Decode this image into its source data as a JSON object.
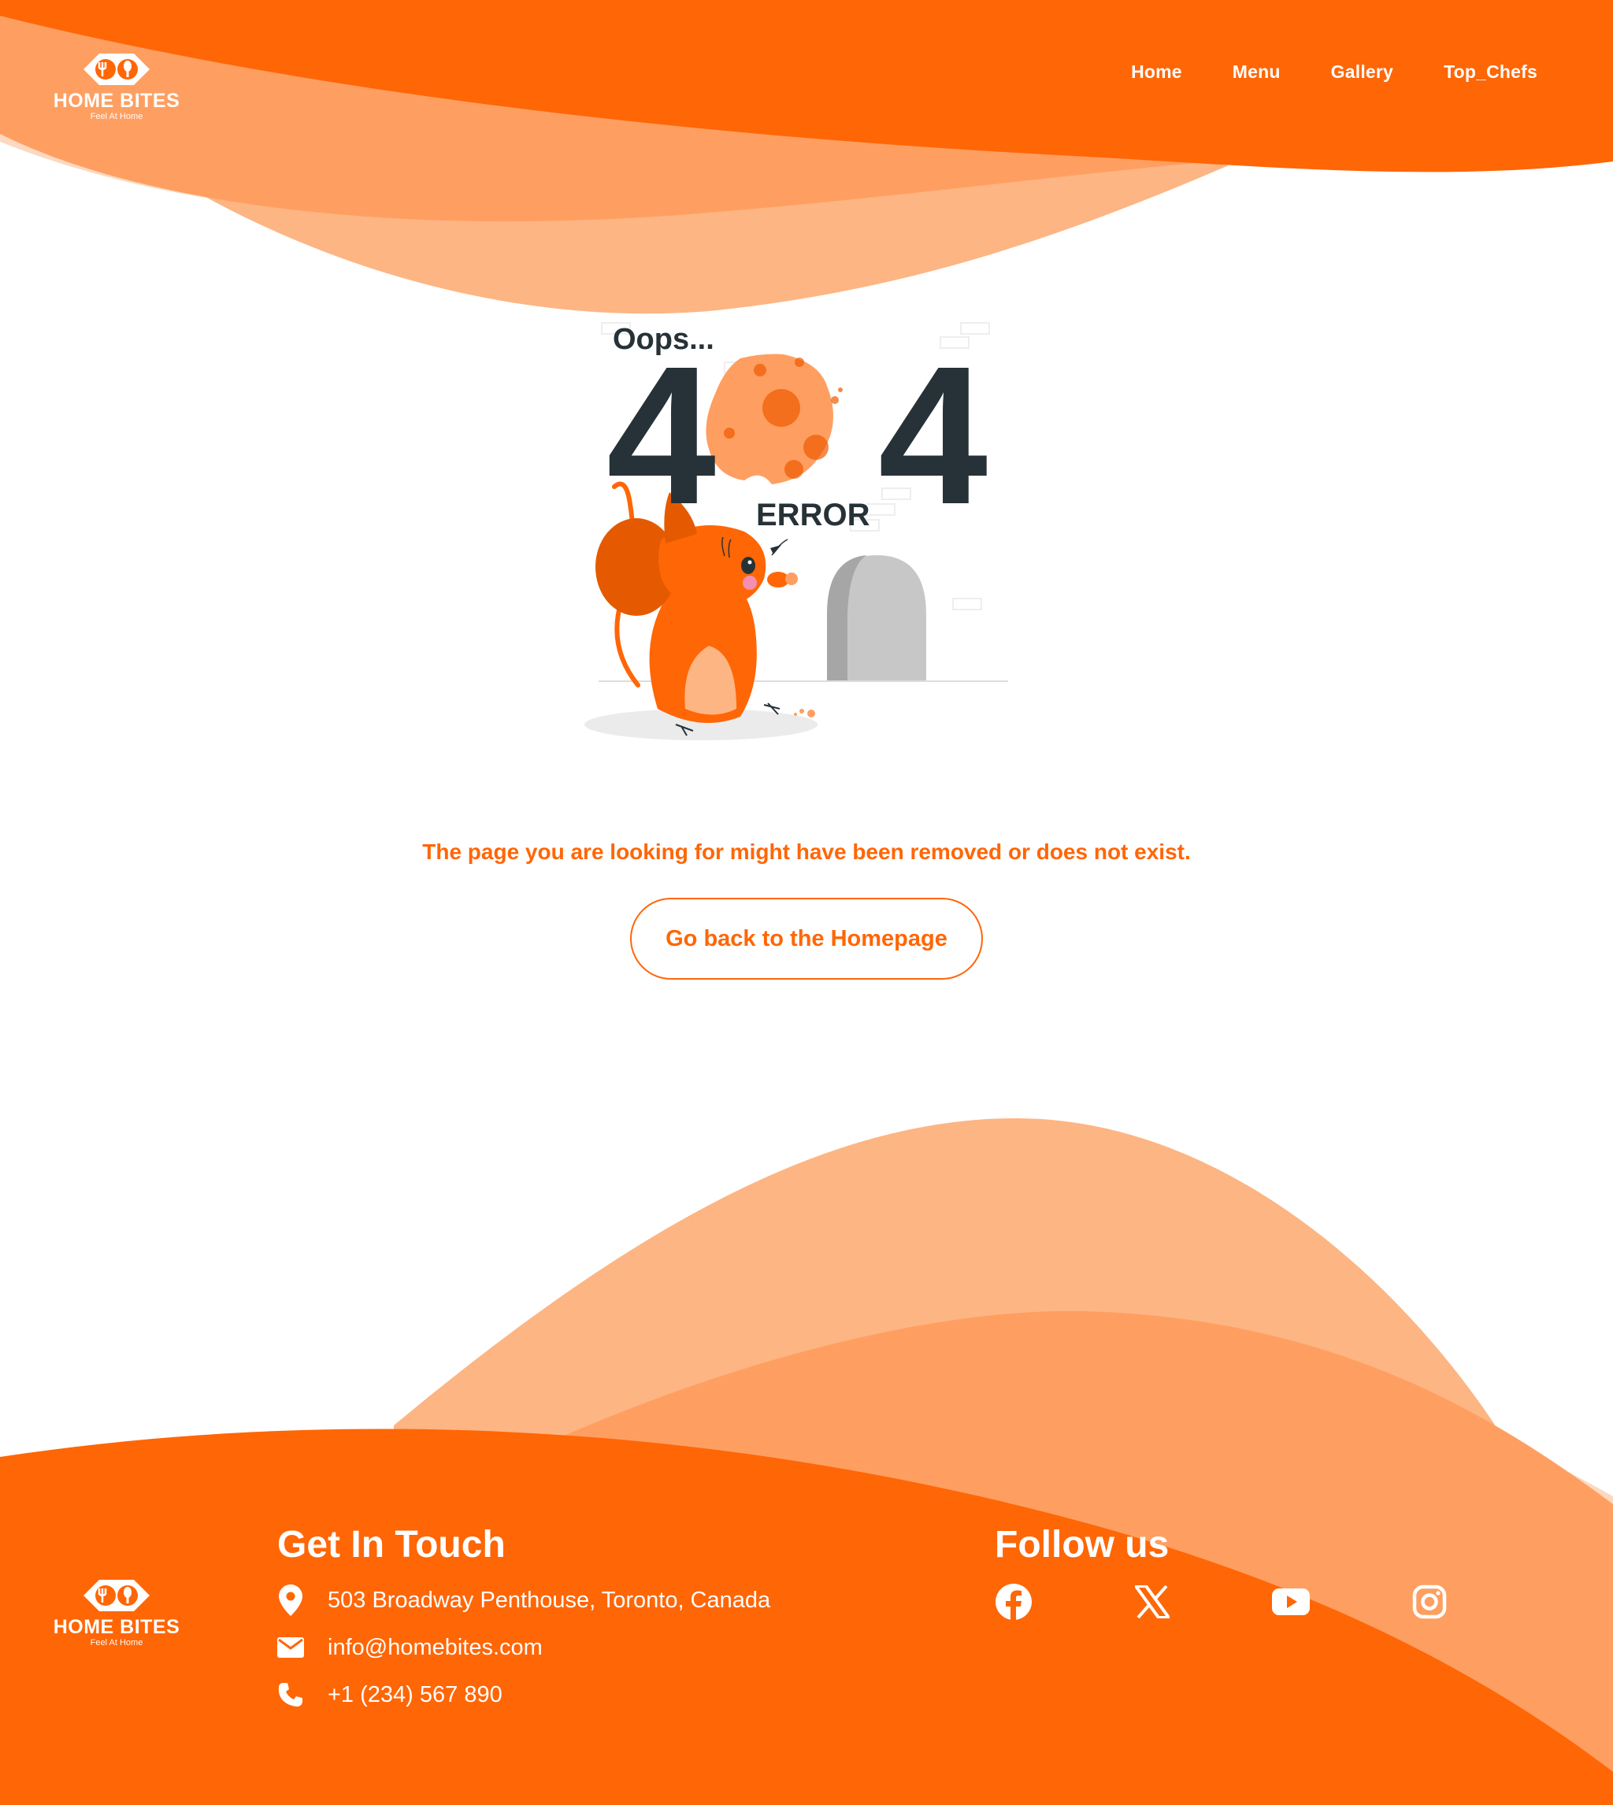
{
  "brand": {
    "name": "HOME BITES",
    "tagline": "Feel At Home"
  },
  "nav": {
    "items": [
      {
        "label": "Home"
      },
      {
        "label": "Menu"
      },
      {
        "label": "Gallery"
      },
      {
        "label": "Top_Chefs"
      }
    ]
  },
  "illustration": {
    "oops": "Oops...",
    "code_left": "4",
    "code_right": "4",
    "error_label": "ERROR"
  },
  "main": {
    "message": "The page you are looking for might have been removed or does not exist.",
    "button_label": "Go back to the Homepage"
  },
  "footer": {
    "contact_heading": "Get In Touch",
    "address": "503 Broadway Penthouse, Toronto, Canada",
    "email": "info@homebites.com",
    "phone": "+1 (234) 567 890",
    "follow_heading": "Follow us",
    "social": [
      {
        "icon": "facebook-icon"
      },
      {
        "icon": "x-twitter-icon"
      },
      {
        "icon": "youtube-icon"
      },
      {
        "icon": "instagram-icon"
      }
    ]
  },
  "colors": {
    "primary": "#ff6606",
    "wave_medium": "#fe9f61",
    "wave_light": "#fdb583",
    "wave_pale": "#fcd9c0",
    "text_dark": "#263238"
  }
}
